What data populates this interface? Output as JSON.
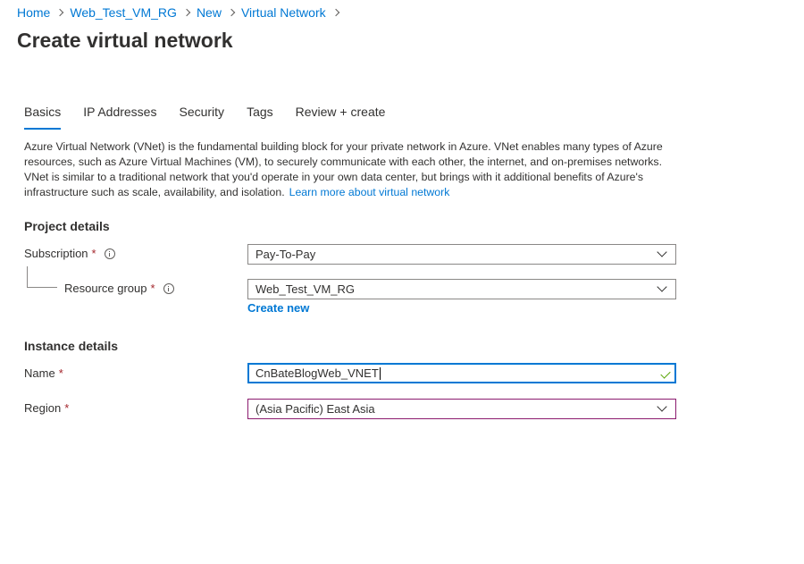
{
  "breadcrumb": [
    "Home",
    "Web_Test_VM_RG",
    "New",
    "Virtual Network"
  ],
  "page_title": "Create virtual network",
  "tabs": [
    {
      "label": "Basics",
      "active": true
    },
    {
      "label": "IP Addresses",
      "active": false
    },
    {
      "label": "Security",
      "active": false
    },
    {
      "label": "Tags",
      "active": false
    },
    {
      "label": "Review + create",
      "active": false
    }
  ],
  "description": {
    "text": "Azure Virtual Network (VNet) is the fundamental building block for your private network in Azure. VNet enables many types of Azure resources, such as Azure Virtual Machines (VM), to securely communicate with each other, the internet, and on-premises networks. VNet is similar to a traditional network that you'd operate in your own data center, but brings with it additional benefits of Azure's infrastructure such as scale, availability, and isolation.",
    "link": "Learn more about virtual network"
  },
  "project_details": {
    "title": "Project details",
    "subscription": {
      "label": "Subscription",
      "required": "*",
      "value": "Pay-To-Pay"
    },
    "resource_group": {
      "label": "Resource group",
      "required": "*",
      "value": "Web_Test_VM_RG",
      "create_new": "Create new"
    }
  },
  "instance_details": {
    "title": "Instance details",
    "name": {
      "label": "Name",
      "required": "*",
      "value": "CnBateBlogWeb_VNET"
    },
    "region": {
      "label": "Region",
      "required": "*",
      "value": "(Asia Pacific) East Asia"
    }
  },
  "colors": {
    "accent": "#0078d4",
    "required": "#a4262c",
    "valid": "#57a300",
    "region_border": "#8b1a6e"
  },
  "icons": [
    "chevron-right-icon",
    "info-icon",
    "chevron-down-icon",
    "checkmark-icon"
  ]
}
